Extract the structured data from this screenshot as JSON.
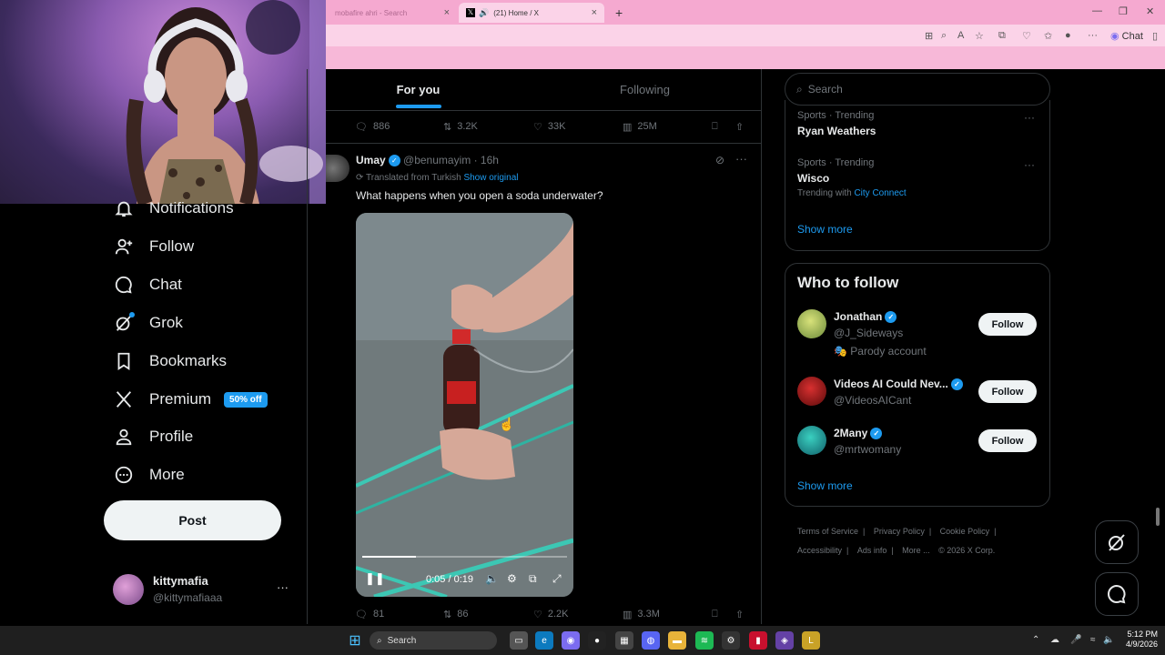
{
  "browser": {
    "tabs": [
      {
        "label": "mobafire ahri - Search",
        "close": "×"
      },
      {
        "label": "(21) Home / X",
        "close": "×"
      }
    ],
    "new_tab": "+",
    "chat_label": "Chat",
    "accent": "#f5a9d0"
  },
  "sidebar": {
    "items": [
      {
        "label": "Notifications",
        "icon": "bell-icon"
      },
      {
        "label": "Follow",
        "icon": "follow-icon"
      },
      {
        "label": "Chat",
        "icon": "chat-icon"
      },
      {
        "label": "Grok",
        "icon": "grok-icon"
      },
      {
        "label": "Bookmarks",
        "icon": "bookmark-icon"
      },
      {
        "label": "Premium",
        "icon": "x-icon",
        "badge": "50% off"
      },
      {
        "label": "Profile",
        "icon": "profile-icon"
      },
      {
        "label": "More",
        "icon": "more-icon"
      }
    ],
    "post_button": "Post",
    "account": {
      "name": "kittymafia",
      "handle": "@kittymafiaaa",
      "menu": "···"
    }
  },
  "feed": {
    "tabs": [
      "For you",
      "Following"
    ],
    "prev_actions": {
      "replies": "886",
      "reposts": "3.2K",
      "likes": "33K",
      "views": "25M"
    },
    "tweet": {
      "name": "Umay",
      "handle": "@benumayim",
      "time": "· 16h",
      "translated": "Translated from Turkish",
      "show_original": "Show original",
      "text": "What happens when you open a soda underwater?",
      "video": {
        "time": "0:05 / 0:19",
        "progress": 0.26
      },
      "actions": {
        "replies": "81",
        "reposts": "86",
        "likes": "2.2K",
        "views": "3.3M"
      }
    }
  },
  "right": {
    "search_placeholder": "Search",
    "trends": [
      {
        "category": "Sports · Trending",
        "name": "Ryan Weathers"
      },
      {
        "category": "Sports · Trending",
        "name": "Wisco",
        "extra_prefix": "Trending with",
        "extra_link": "City Connect"
      }
    ],
    "trends_show_more": "Show more",
    "who_to_follow_title": "Who to follow",
    "who": [
      {
        "name": "Jonathan",
        "handle": "@J_Sideways",
        "note": "Parody account",
        "button": "Follow"
      },
      {
        "name": "Videos AI Could Nev...",
        "handle": "@VideosAICant",
        "button": "Follow"
      },
      {
        "name": "2Many",
        "handle": "@mrtwomany",
        "button": "Follow"
      }
    ],
    "who_show_more": "Show more",
    "footer": [
      "Terms of Service",
      "Privacy Policy",
      "Cookie Policy",
      "Accessibility",
      "Ads info",
      "More ...",
      "© 2026 X Corp."
    ]
  },
  "taskbar": {
    "search": "Search",
    "time": "5:12 PM",
    "date": "4/9/2026"
  }
}
